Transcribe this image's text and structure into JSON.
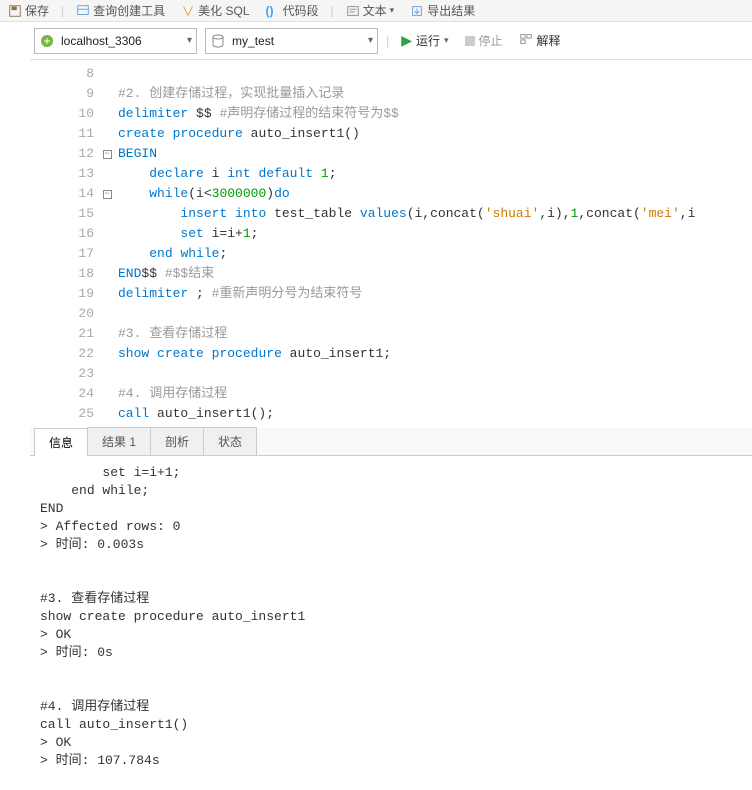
{
  "toolbar": {
    "save": "保存",
    "queryBuilder": "查询创建工具",
    "beautifySql": "美化 SQL",
    "codeSnippet": "代码段",
    "text": "文本",
    "exportResult": "导出结果"
  },
  "secondary": {
    "connection": "localhost_3306",
    "database": "my_test",
    "run": "运行",
    "stop": "停止",
    "explain": "解释"
  },
  "code": {
    "startLine": 8,
    "lines": [
      {
        "n": 8,
        "segs": [
          {
            "t": "",
            "c": ""
          }
        ]
      },
      {
        "n": 9,
        "segs": [
          {
            "t": "#2. 创建存储过程，实现批量插入记录",
            "c": "c-comment"
          }
        ]
      },
      {
        "n": 10,
        "segs": [
          {
            "t": "delimiter",
            "c": "c-kw"
          },
          {
            "t": " $$ ",
            "c": "c-punc"
          },
          {
            "t": "#声明存储过程的结束符号为$$",
            "c": "c-comment"
          }
        ]
      },
      {
        "n": 11,
        "segs": [
          {
            "t": "create",
            "c": "c-kw"
          },
          {
            "t": " ",
            "c": ""
          },
          {
            "t": "procedure",
            "c": "c-kw"
          },
          {
            "t": " auto_insert1()",
            "c": "c-id"
          }
        ]
      },
      {
        "n": 12,
        "fold": "open",
        "segs": [
          {
            "t": "BEGIN",
            "c": "c-kw"
          }
        ]
      },
      {
        "n": 13,
        "segs": [
          {
            "t": "    ",
            "c": ""
          },
          {
            "t": "declare",
            "c": "c-kw"
          },
          {
            "t": " i ",
            "c": "c-id"
          },
          {
            "t": "int",
            "c": "c-kw"
          },
          {
            "t": " ",
            "c": ""
          },
          {
            "t": "default",
            "c": "c-kw"
          },
          {
            "t": " ",
            "c": ""
          },
          {
            "t": "1",
            "c": "c-num"
          },
          {
            "t": ";",
            "c": "c-punc"
          }
        ]
      },
      {
        "n": 14,
        "fold": "open",
        "segs": [
          {
            "t": "    ",
            "c": ""
          },
          {
            "t": "while",
            "c": "c-kw"
          },
          {
            "t": "(i<",
            "c": "c-punc"
          },
          {
            "t": "3000000",
            "c": "c-num"
          },
          {
            "t": ")",
            "c": "c-punc"
          },
          {
            "t": "do",
            "c": "c-kw"
          }
        ]
      },
      {
        "n": 15,
        "segs": [
          {
            "t": "        ",
            "c": ""
          },
          {
            "t": "insert",
            "c": "c-kw"
          },
          {
            "t": " ",
            "c": ""
          },
          {
            "t": "into",
            "c": "c-kw"
          },
          {
            "t": " test_table ",
            "c": "c-id"
          },
          {
            "t": "values",
            "c": "c-kw"
          },
          {
            "t": "(i,concat(",
            "c": "c-punc"
          },
          {
            "t": "'shuai'",
            "c": "c-str"
          },
          {
            "t": ",i),",
            "c": "c-punc"
          },
          {
            "t": "1",
            "c": "c-num"
          },
          {
            "t": ",concat(",
            "c": "c-punc"
          },
          {
            "t": "'mei'",
            "c": "c-str"
          },
          {
            "t": ",i",
            "c": "c-punc"
          }
        ]
      },
      {
        "n": 16,
        "segs": [
          {
            "t": "        ",
            "c": ""
          },
          {
            "t": "set",
            "c": "c-kw"
          },
          {
            "t": " i=i+",
            "c": "c-punc"
          },
          {
            "t": "1",
            "c": "c-num"
          },
          {
            "t": ";",
            "c": "c-punc"
          }
        ]
      },
      {
        "n": 17,
        "segs": [
          {
            "t": "    ",
            "c": ""
          },
          {
            "t": "end",
            "c": "c-kw"
          },
          {
            "t": " ",
            "c": ""
          },
          {
            "t": "while",
            "c": "c-kw"
          },
          {
            "t": ";",
            "c": "c-punc"
          }
        ]
      },
      {
        "n": 18,
        "segs": [
          {
            "t": "END",
            "c": "c-kw"
          },
          {
            "t": "$$ ",
            "c": "c-punc"
          },
          {
            "t": "#$$结束",
            "c": "c-comment"
          }
        ]
      },
      {
        "n": 19,
        "segs": [
          {
            "t": "delimiter",
            "c": "c-kw"
          },
          {
            "t": " ; ",
            "c": "c-punc"
          },
          {
            "t": "#重新声明分号为结束符号",
            "c": "c-comment"
          }
        ]
      },
      {
        "n": 20,
        "segs": [
          {
            "t": "",
            "c": ""
          }
        ]
      },
      {
        "n": 21,
        "segs": [
          {
            "t": "#3. 查看存储过程",
            "c": "c-comment"
          }
        ]
      },
      {
        "n": 22,
        "segs": [
          {
            "t": "show",
            "c": "c-kw"
          },
          {
            "t": " ",
            "c": ""
          },
          {
            "t": "create",
            "c": "c-kw"
          },
          {
            "t": " ",
            "c": ""
          },
          {
            "t": "procedure",
            "c": "c-kw"
          },
          {
            "t": " auto_insert1;",
            "c": "c-id"
          }
        ]
      },
      {
        "n": 23,
        "segs": [
          {
            "t": "",
            "c": ""
          }
        ]
      },
      {
        "n": 24,
        "segs": [
          {
            "t": "#4. 调用存储过程",
            "c": "c-comment"
          }
        ]
      },
      {
        "n": 25,
        "segs": [
          {
            "t": "call",
            "c": "c-kw"
          },
          {
            "t": " auto_insert1();",
            "c": "c-id"
          }
        ]
      }
    ]
  },
  "tabs": {
    "info": "信息",
    "result1": "结果 1",
    "analysis": "剖析",
    "status": "状态"
  },
  "output": "        set i=i+1;\n    end while;\nEND\n> Affected rows: 0\n> 时间: 0.003s\n\n\n#3. 查看存储过程\nshow create procedure auto_insert1\n> OK\n> 时间: 0s\n\n\n#4. 调用存储过程\ncall auto_insert1()\n> OK\n> 时间: 107.784s"
}
